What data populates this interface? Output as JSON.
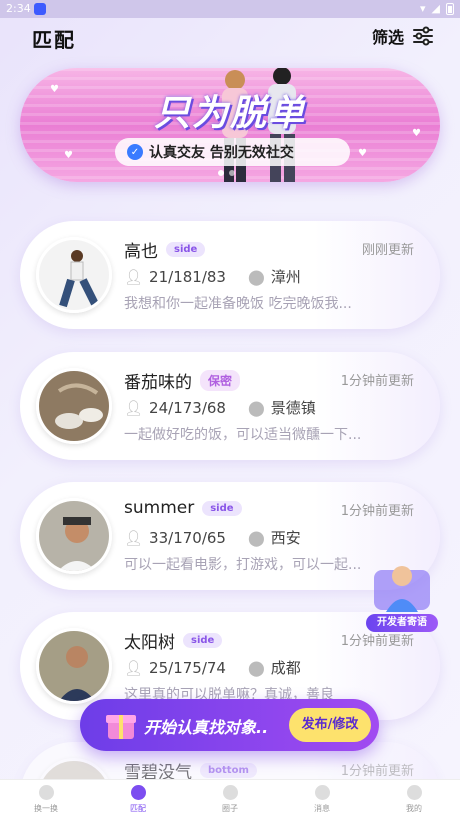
{
  "status_bar": {
    "time": "2:34"
  },
  "header": {
    "title": "匹配",
    "filter_label": "筛选"
  },
  "banner": {
    "headline": "只为脱单",
    "tagline": "认真交友 告别无效社交"
  },
  "profiles": [
    {
      "name": "高也",
      "badge": "side",
      "updated": "刚刚更新",
      "stats": "21/181/83",
      "city": "漳州",
      "desc": "我想和你一起准备晚饭 吃完晚饭我..."
    },
    {
      "name": "番茄味的",
      "badge": "保密",
      "updated": "1分钟前更新",
      "stats": "24/173/68",
      "city": "景德镇",
      "desc": "一起做好吃的饭，可以适当微醺一下..."
    },
    {
      "name": "summer",
      "badge": "side",
      "updated": "1分钟前更新",
      "stats": "33/170/65",
      "city": "西安",
      "desc": "可以一起看电影，打游戏，可以一起..."
    },
    {
      "name": "太阳树",
      "badge": "side",
      "updated": "1分钟前更新",
      "stats": "25/175/74",
      "city": "成都",
      "desc": "这里真的可以脱单嘛？真诚，善良"
    },
    {
      "name": "雪碧没气",
      "badge": "bottom",
      "updated": "1分钟前更新",
      "stats": "",
      "city": "",
      "desc": ""
    }
  ],
  "fab": {
    "label": "开始认真找对象..",
    "button": "发布/修改"
  },
  "floating_widget": {
    "label": "开发者寄语"
  },
  "tabbar": [
    {
      "label": "换一换"
    },
    {
      "label": "匹配"
    },
    {
      "label": "圈子"
    },
    {
      "label": "消息"
    },
    {
      "label": "我的"
    }
  ],
  "colors": {
    "accent": "#7c4df0",
    "fab_button": "#fde26d",
    "badge_bg": "#ece4fd"
  }
}
